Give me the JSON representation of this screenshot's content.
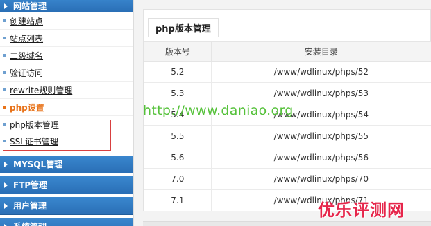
{
  "sidebar": {
    "site_manage": "网站管理",
    "items": [
      {
        "label": "创建站点"
      },
      {
        "label": "站点列表"
      },
      {
        "label": "二级域名"
      },
      {
        "label": "验证访问"
      },
      {
        "label": "rewrite规则管理"
      },
      {
        "label": "php设置"
      },
      {
        "label": "php版本管理"
      },
      {
        "label": "SSL证书管理"
      }
    ],
    "sections": [
      {
        "label": "MYSQL管理"
      },
      {
        "label": "FTP管理"
      },
      {
        "label": "用户管理"
      },
      {
        "label": "系统管理"
      }
    ]
  },
  "panel": {
    "title": "php版本管理",
    "headers": {
      "version": "版本号",
      "dir": "安装目录"
    },
    "rows": [
      {
        "version": "5.2",
        "dir": "/www/wdlinux/phps/52"
      },
      {
        "version": "5.3",
        "dir": "/www/wdlinux/phps/53"
      },
      {
        "version": "5.4",
        "dir": "/www/wdlinux/phps/54"
      },
      {
        "version": "5.5",
        "dir": "/www/wdlinux/phps/55"
      },
      {
        "version": "5.6",
        "dir": "/www/wdlinux/phps/56"
      },
      {
        "version": "7.0",
        "dir": "/www/wdlinux/phps/70"
      },
      {
        "version": "7.1",
        "dir": "/www/wdlinux/phps/71"
      }
    ]
  },
  "watermarks": {
    "url": "http://www.daniao.org",
    "brand": "优乐评测网"
  },
  "colors": {
    "sidebar_header": "#2a6fb6",
    "active_item": "#e8731a",
    "highlight_border": "#d84040",
    "url_watermark": "#55c13a",
    "brand_watermark": "#e6264b"
  }
}
